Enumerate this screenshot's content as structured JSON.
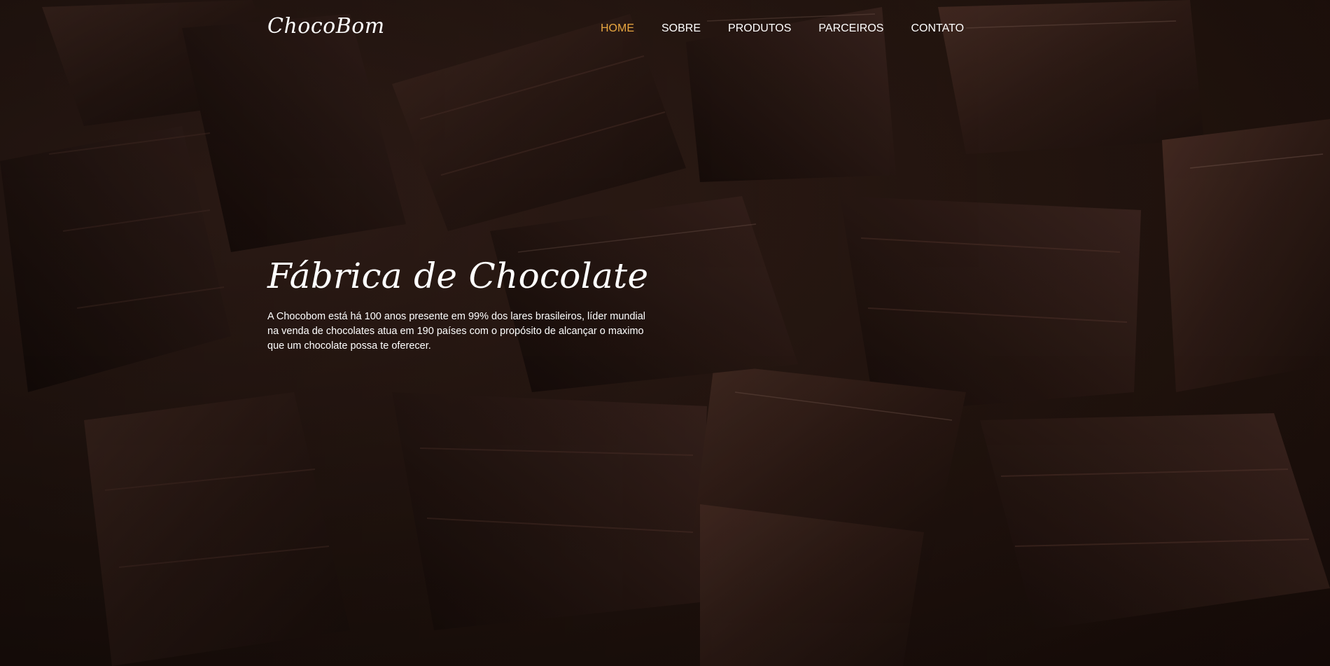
{
  "header": {
    "logo": "ChocoBom",
    "nav": [
      {
        "label": "HOME",
        "active": true
      },
      {
        "label": "SOBRE",
        "active": false
      },
      {
        "label": "PRODUTOS",
        "active": false
      },
      {
        "label": "PARCEIROS",
        "active": false
      },
      {
        "label": "CONTATO",
        "active": false
      }
    ]
  },
  "hero": {
    "title": "Fábrica de Chocolate",
    "text": "A Chocobom está há 100 anos presente em 99% dos lares brasileiros, líder mundial na venda de chocolates atua em 190 países com o propósito de alcançar o maximo que um chocolate possa te oferecer.",
    "background": "dark chocolate bars photo"
  },
  "colors": {
    "accent": "#e8a640",
    "text": "#ffffff",
    "background": "#24150f"
  }
}
